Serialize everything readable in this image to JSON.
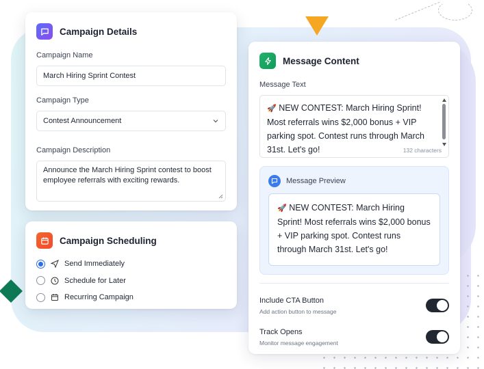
{
  "details": {
    "title": "Campaign Details",
    "name_label": "Campaign Name",
    "name_value": "March Hiring Sprint Contest",
    "type_label": "Campaign Type",
    "type_value": "Contest Announcement",
    "desc_label": "Campaign Description",
    "desc_value": "Announce the March Hiring Sprint contest to boost employee referrals with exciting rewards."
  },
  "scheduling": {
    "title": "Campaign Scheduling",
    "options": [
      {
        "label": "Send Immediately",
        "icon": "send-icon",
        "selected": true
      },
      {
        "label": "Schedule for Later",
        "icon": "clock-icon",
        "selected": false
      },
      {
        "label": "Recurring Campaign",
        "icon": "calendar-icon",
        "selected": false
      }
    ]
  },
  "message": {
    "title": "Message Content",
    "text_label": "Message Text",
    "emoji": "🚀",
    "text_value": "NEW CONTEST: March Hiring Sprint! Most referrals wins $2,000 bonus + VIP parking spot. Contest runs through March 31st. Let's go!",
    "char_count": "132 characters",
    "preview_label": "Message Preview",
    "preview_text": "NEW CONTEST: March Hiring Sprint! Most referrals wins $2,000 bonus + VIP parking spot. Contest runs through March 31st. Let's go!",
    "toggles": [
      {
        "title": "Include CTA Button",
        "subtitle": "Add action button to message",
        "on": true
      },
      {
        "title": "Track Opens",
        "subtitle": "Monitor message engagement",
        "on": true
      }
    ]
  },
  "colors": {
    "accent_blue": "#2b6fe6",
    "details_icon": "#6a5cf2",
    "schedule_icon": "#f15a2d",
    "message_icon": "#1aa763",
    "decor_triangle": "#f5a623",
    "decor_diamond": "#0e7a55"
  }
}
